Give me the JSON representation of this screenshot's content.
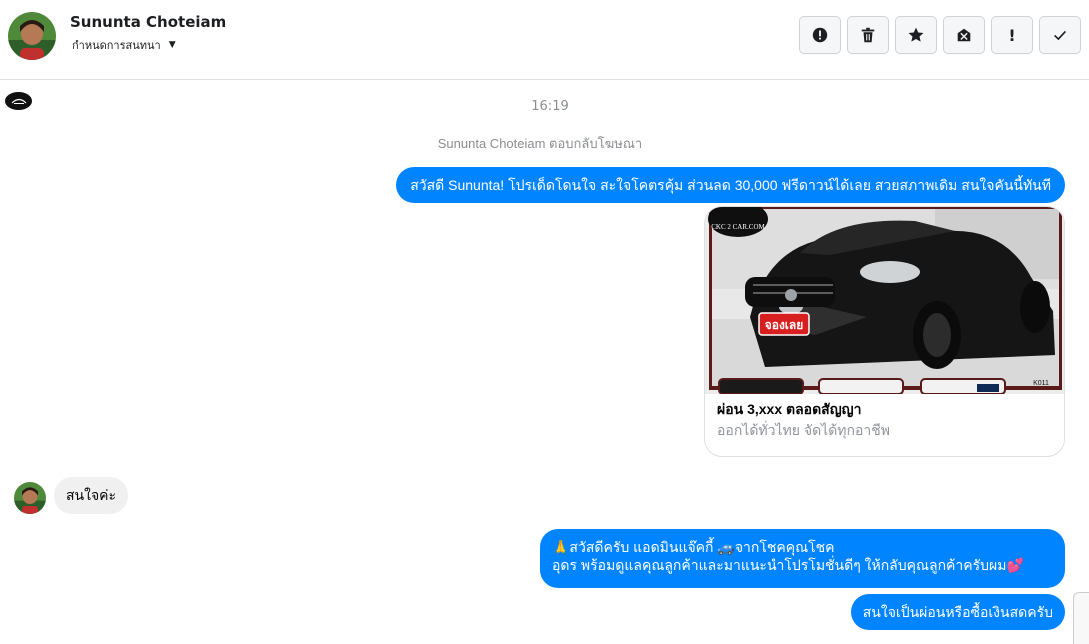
{
  "header": {
    "contact_name": "Sununta Choteiam",
    "assign_label": "กำหนดการสนทนา",
    "toolbar": [
      {
        "name": "report-spam-button",
        "icon": "alert-circle-icon"
      },
      {
        "name": "delete-button",
        "icon": "trash-icon"
      },
      {
        "name": "star-button",
        "icon": "star-icon"
      },
      {
        "name": "mark-unread-button",
        "icon": "envelope-x-icon"
      },
      {
        "name": "follow-up-button",
        "icon": "exclamation-icon",
        "glyph": "!"
      },
      {
        "name": "mark-done-button",
        "icon": "check-icon"
      }
    ]
  },
  "chat": {
    "timestamp": "16:19",
    "reply_note": "Sununta Choteiam ตอบกลับโฆษณา",
    "messages": {
      "outgoing_1": "สวัสดี Sununta! โปรเด็ดโดนใจ สะใจโคตรคุ้ม ส่วนลด 30,000 ฟรีดาวน์ได้เลย สวยสภาพเดิม สนใจคันนี้ทันที",
      "incoming_1": "สนใจค่ะ",
      "outgoing_2_line1": "🙏สวัสดีครับ แอดมินแจ๊คกี้ 🚙จากโชคคุณโชค",
      "outgoing_2_line2": "อุดร พร้อมดูแลคุณลูกค้าและมาแนะนำโปรโมชั่นดีๆ ให้กลับคุณลูกค้าครับผม💕",
      "outgoing_3": "สนใจเป็นผ่อนหรือซื้อเงินสดครับ"
    },
    "ad_card": {
      "title": "ผ่อน 3,xxx ตลอดสัญญา",
      "subtitle": "ออกได้ทั่วไทย จัดได้ทุกอาชีพ",
      "logo_text": "CKC 2 CAR.COM",
      "badge_text": "จองเลย",
      "stock_code": "K011"
    }
  },
  "colors": {
    "outgoing_bubble": "#0084ff",
    "incoming_bubble": "#f0f0f0",
    "meta_text": "#8a8d91"
  }
}
